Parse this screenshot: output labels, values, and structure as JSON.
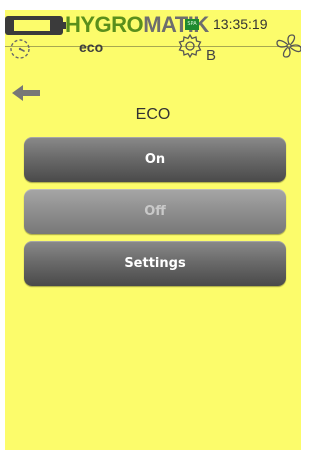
{
  "status_bar": {
    "brand_part1": "HYGRO",
    "brand_part2": "MATIK",
    "badge": "SPA",
    "time": "13:35:19",
    "battery_icon": "battery-icon"
  },
  "nav": {
    "mode_label": "eco",
    "settings_suffix": "B",
    "icons": [
      "timer-icon",
      "gear-icon",
      "fan-icon"
    ]
  },
  "page": {
    "title": "ECO",
    "back_icon": "back-arrow-icon"
  },
  "menu": {
    "on_label": "On",
    "off_label": "Off",
    "settings_label": "Settings",
    "off_disabled": true
  },
  "colors": {
    "background": "#fcfc6b",
    "button": "#6b6b6b",
    "button_disabled": "#8e8e8e",
    "brand_green": "#5a8f1c",
    "brand_gray": "#6e6e6e"
  }
}
